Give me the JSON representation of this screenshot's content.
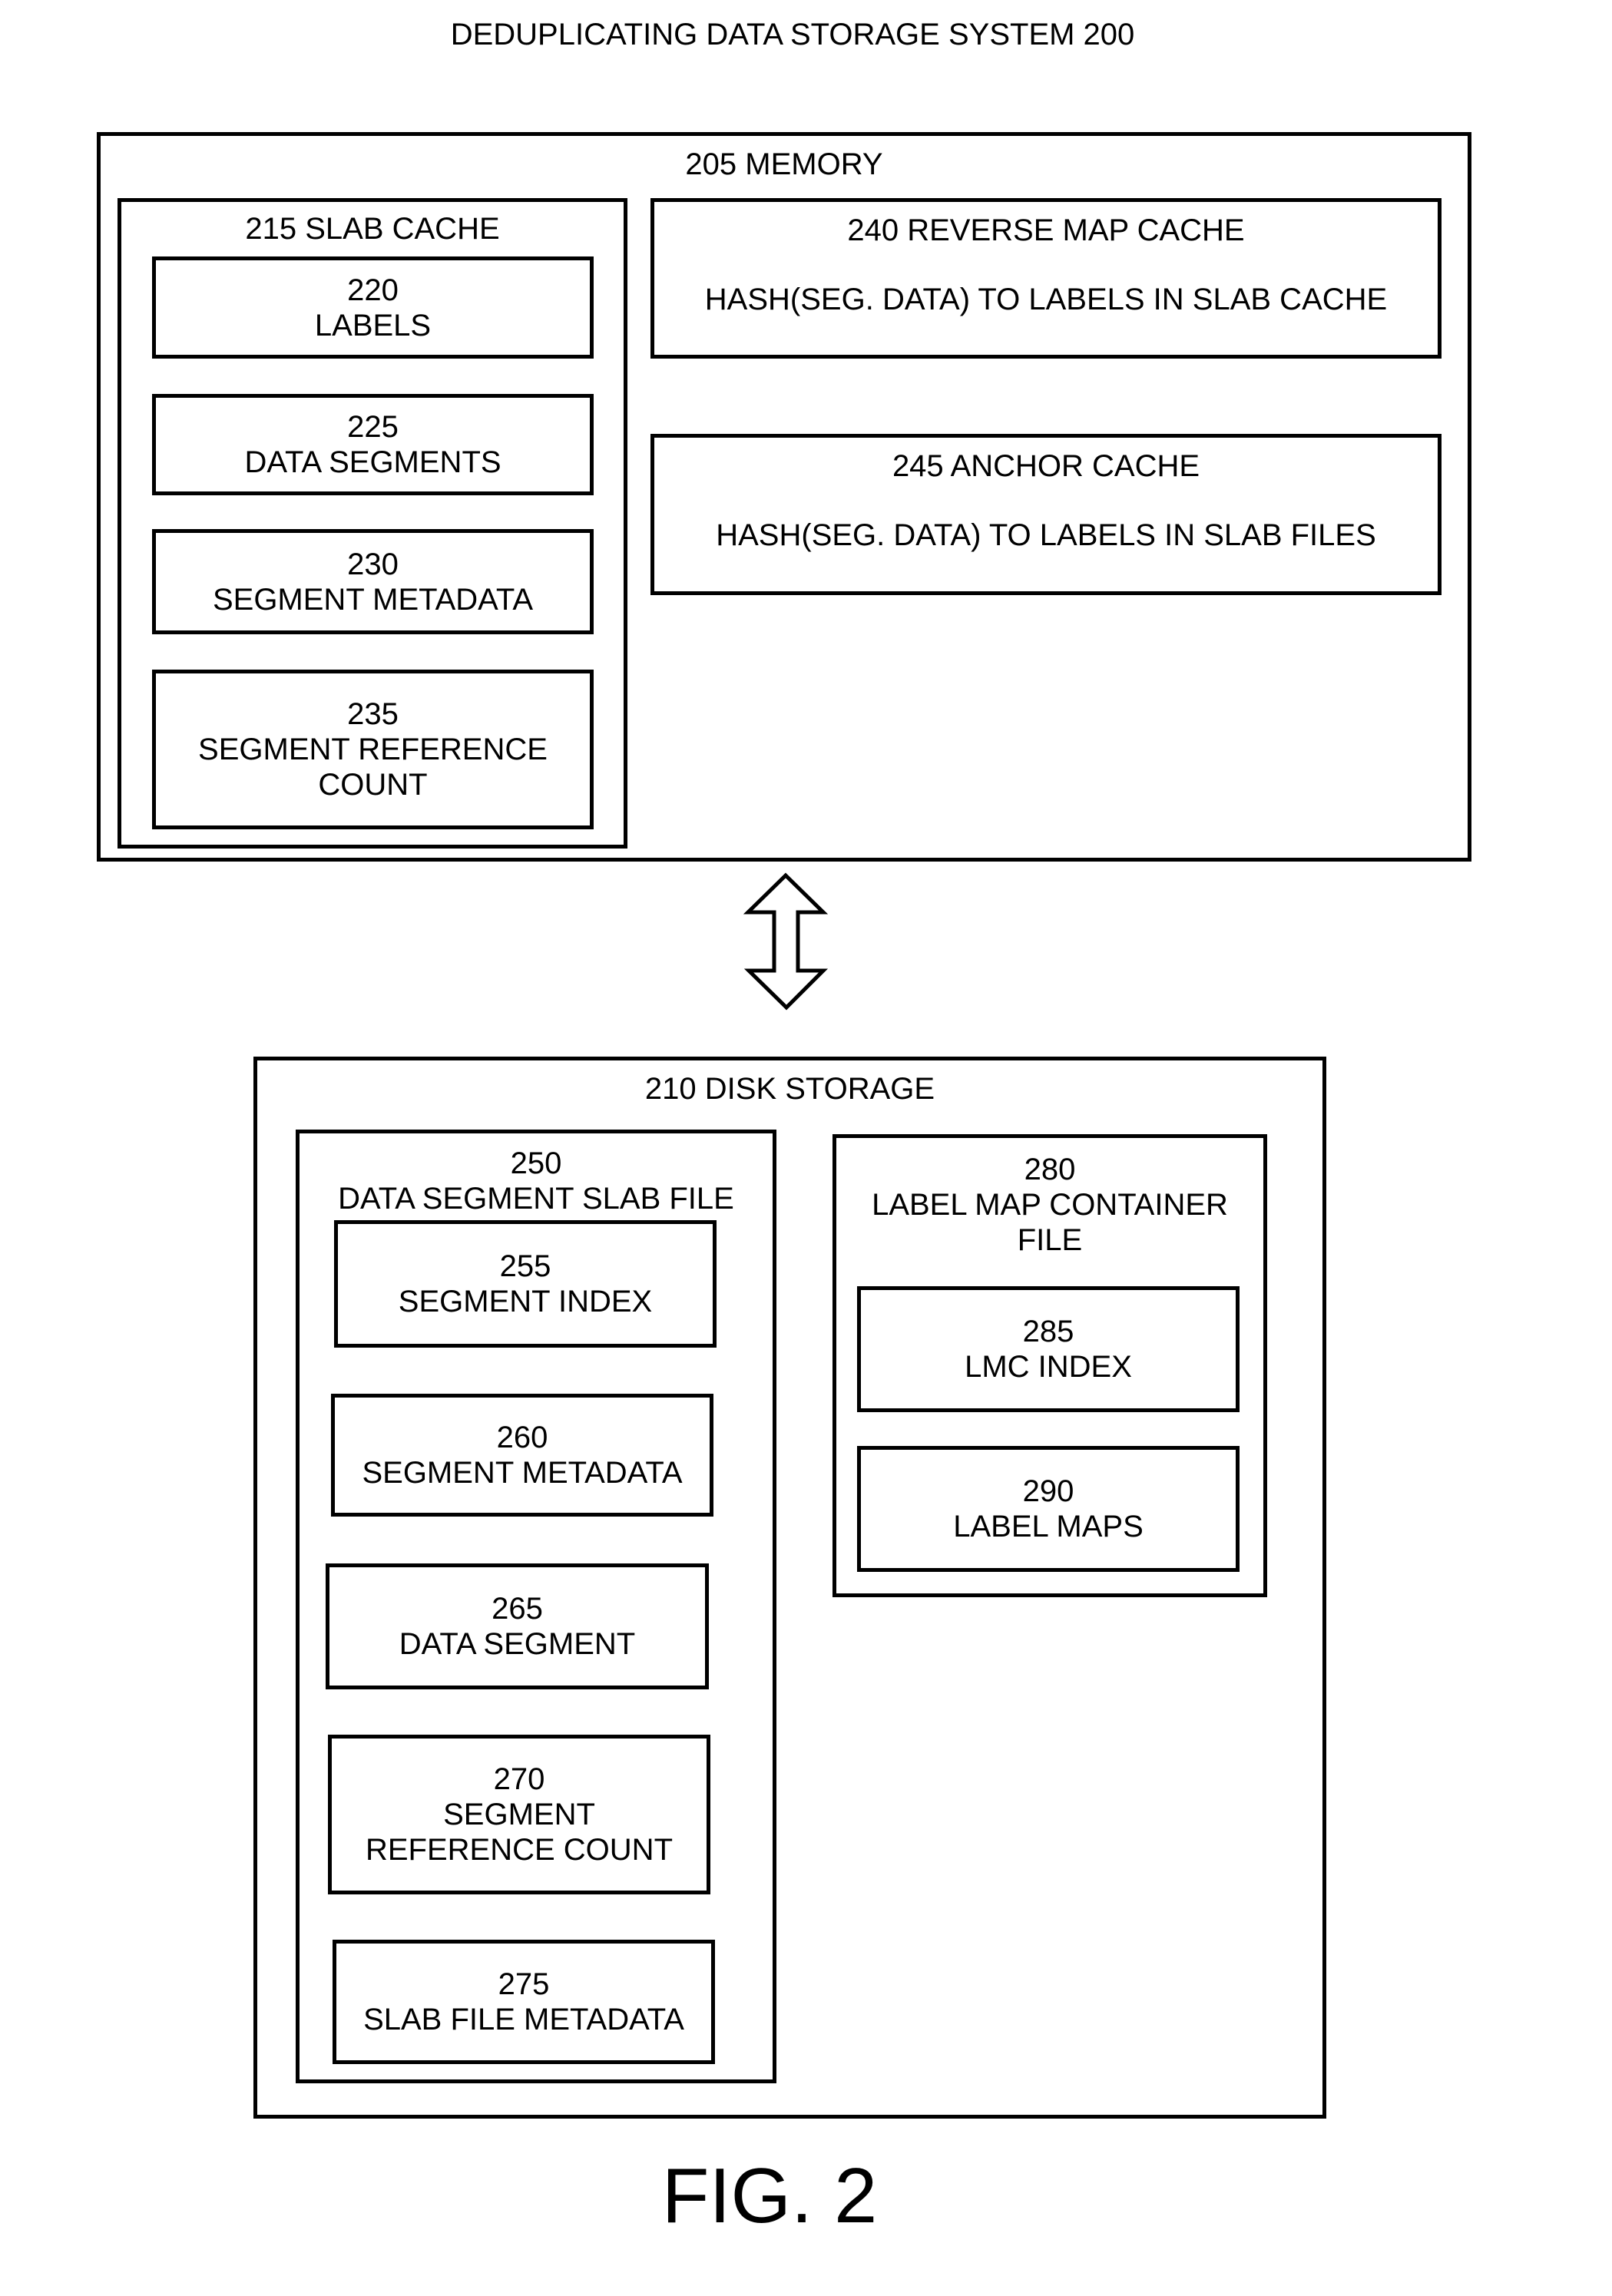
{
  "title": "DEDUPLICATING DATA STORAGE SYSTEM 200",
  "figure_label": "FIG. 2",
  "memory": {
    "label": "205 MEMORY",
    "slab_cache": {
      "label": "215 SLAB CACHE",
      "items": [
        {
          "number": "220",
          "lines": [
            "LABELS"
          ]
        },
        {
          "number": "225",
          "lines": [
            "DATA SEGMENTS"
          ]
        },
        {
          "number": "230",
          "lines": [
            "SEGMENT METADATA"
          ]
        },
        {
          "number": "235",
          "lines": [
            "SEGMENT REFERENCE",
            "COUNT"
          ]
        }
      ]
    },
    "reverse_map_cache": {
      "label": "240 REVERSE MAP CACHE",
      "description": "HASH(SEG. DATA) TO LABELS IN SLAB CACHE"
    },
    "anchor_cache": {
      "label": "245 ANCHOR CACHE",
      "description": "HASH(SEG. DATA) TO LABELS IN SLAB FILES"
    }
  },
  "connector": {
    "icon": "double-headed-vertical-arrow"
  },
  "disk_storage": {
    "label": "210 DISK STORAGE",
    "slab_file": {
      "number": "250",
      "label": "DATA SEGMENT SLAB FILE",
      "items": [
        {
          "number": "255",
          "lines": [
            "SEGMENT INDEX"
          ]
        },
        {
          "number": "260",
          "lines": [
            "SEGMENT METADATA"
          ]
        },
        {
          "number": "265",
          "lines": [
            "DATA SEGMENT"
          ]
        },
        {
          "number": "270",
          "lines": [
            "SEGMENT",
            "REFERENCE COUNT"
          ]
        },
        {
          "number": "275",
          "lines": [
            "SLAB FILE METADATA"
          ]
        }
      ]
    },
    "label_map_container": {
      "number": "280",
      "lines": [
        "LABEL MAP CONTAINER",
        "FILE"
      ],
      "items": [
        {
          "number": "285",
          "lines": [
            "LMC INDEX"
          ]
        },
        {
          "number": "290",
          "lines": [
            "LABEL MAPS"
          ]
        }
      ]
    }
  }
}
